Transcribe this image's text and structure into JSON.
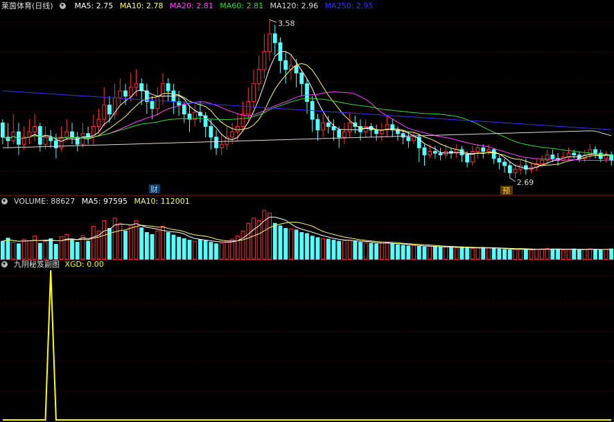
{
  "main_header": {
    "title": "莱茵体育(日线)",
    "ma5": "MA5: 2.75",
    "ma10": "MA10: 2.78",
    "ma20": "MA20: 2.81",
    "ma60": "MA60: 2.81",
    "ma120": "MA120: 2.96",
    "ma250": "MA250: 2.95"
  },
  "volume_header": {
    "title": "VOLUME: 88627",
    "ma5": "MA5: 97595",
    "ma10": "MA10: 112001"
  },
  "indicator_header": {
    "title": "九阴秘笈副图",
    "xgd": "XGD: 0.00"
  },
  "annotations": {
    "high_label": "3.58",
    "low_label": "2.69",
    "event_badge_1": "财",
    "event_badge_2": "预"
  },
  "colors": {
    "up": "#ff3333",
    "down": "#54ffff",
    "ma5": "#ffffff",
    "ma10": "#ffff66",
    "ma20": "#ff44ff",
    "ma60": "#33dd33",
    "ma120": "#dddddd",
    "ma250": "#3333ff",
    "divider": "#aa1111",
    "xgd": "#ffff00"
  },
  "chart_data": {
    "type": "candlestick",
    "price_range": [
      2.62,
      3.62
    ],
    "high_value": 3.58,
    "low_value": 2.69,
    "ohlc": [
      [
        3.0,
        2.92,
        3.02,
        2.88
      ],
      [
        2.92,
        2.9,
        3.0,
        2.86
      ],
      [
        2.9,
        2.95,
        3.05,
        2.88
      ],
      [
        2.95,
        2.88,
        3.0,
        2.82
      ],
      [
        2.88,
        2.92,
        2.98,
        2.85
      ],
      [
        2.92,
        2.95,
        3.02,
        2.88
      ],
      [
        2.95,
        2.98,
        3.05,
        2.9
      ],
      [
        2.98,
        2.88,
        3.0,
        2.84
      ],
      [
        2.88,
        2.92,
        2.98,
        2.85
      ],
      [
        2.92,
        2.9,
        2.96,
        2.86
      ],
      [
        2.9,
        2.86,
        2.94,
        2.8
      ],
      [
        2.86,
        2.92,
        2.98,
        2.84
      ],
      [
        2.92,
        2.95,
        3.02,
        2.9
      ],
      [
        2.95,
        2.92,
        3.0,
        2.88
      ],
      [
        2.92,
        2.88,
        2.95,
        2.84
      ],
      [
        2.88,
        2.94,
        3.0,
        2.86
      ],
      [
        2.94,
        2.92,
        2.98,
        2.88
      ],
      [
        2.92,
        2.98,
        3.05,
        2.88
      ],
      [
        2.98,
        3.02,
        3.08,
        2.94
      ],
      [
        3.02,
        3.1,
        3.2,
        2.98
      ],
      [
        3.1,
        3.05,
        3.15,
        3.0
      ],
      [
        3.05,
        3.14,
        3.22,
        3.02
      ],
      [
        3.14,
        3.18,
        3.25,
        3.1
      ],
      [
        3.18,
        3.15,
        3.22,
        3.1
      ],
      [
        3.15,
        3.2,
        3.28,
        3.12
      ],
      [
        3.2,
        3.22,
        3.3,
        3.15
      ],
      [
        3.22,
        3.18,
        3.25,
        3.1
      ],
      [
        3.18,
        3.12,
        3.22,
        3.05
      ],
      [
        3.12,
        3.08,
        3.15,
        3.02
      ],
      [
        3.08,
        3.15,
        3.2,
        3.04
      ],
      [
        3.15,
        3.22,
        3.28,
        3.1
      ],
      [
        3.22,
        3.18,
        3.25,
        3.12
      ],
      [
        3.18,
        3.12,
        3.22,
        3.05
      ],
      [
        3.12,
        3.1,
        3.18,
        3.04
      ],
      [
        3.1,
        3.05,
        3.12,
        3.0
      ],
      [
        3.05,
        3.02,
        3.1,
        2.95
      ],
      [
        3.02,
        3.06,
        3.1,
        2.98
      ],
      [
        3.06,
        3.04,
        3.12,
        3.0
      ],
      [
        3.04,
        2.98,
        3.06,
        2.92
      ],
      [
        2.98,
        2.92,
        3.02,
        2.85
      ],
      [
        2.92,
        2.86,
        2.96,
        2.82
      ],
      [
        2.86,
        2.88,
        2.94,
        2.82
      ],
      [
        2.88,
        2.92,
        2.98,
        2.85
      ],
      [
        2.92,
        2.95,
        3.0,
        2.88
      ],
      [
        2.95,
        2.98,
        3.05,
        2.9
      ],
      [
        2.98,
        3.05,
        3.12,
        2.95
      ],
      [
        3.05,
        3.12,
        3.2,
        3.0
      ],
      [
        3.12,
        3.22,
        3.3,
        3.08
      ],
      [
        3.22,
        3.3,
        3.38,
        3.18
      ],
      [
        3.3,
        3.4,
        3.5,
        3.25
      ],
      [
        3.4,
        3.5,
        3.58,
        3.35
      ],
      [
        3.5,
        3.45,
        3.55,
        3.38
      ],
      [
        3.45,
        3.35,
        3.48,
        3.28
      ],
      [
        3.35,
        3.3,
        3.4,
        3.22
      ],
      [
        3.3,
        3.32,
        3.38,
        3.24
      ],
      [
        3.32,
        3.28,
        3.36,
        3.2
      ],
      [
        3.28,
        3.22,
        3.3,
        3.15
      ],
      [
        3.22,
        3.12,
        3.25,
        3.05
      ],
      [
        3.12,
        3.02,
        3.15,
        2.95
      ],
      [
        3.02,
        2.96,
        3.05,
        2.9
      ],
      [
        2.96,
        3.0,
        3.05,
        2.92
      ],
      [
        3.0,
        2.98,
        3.04,
        2.94
      ],
      [
        2.98,
        2.96,
        3.02,
        2.9
      ],
      [
        2.96,
        2.92,
        2.98,
        2.86
      ],
      [
        2.92,
        2.95,
        3.0,
        2.88
      ],
      [
        2.95,
        3.0,
        3.06,
        2.92
      ],
      [
        3.0,
        2.98,
        3.04,
        2.94
      ],
      [
        2.98,
        2.95,
        3.02,
        2.9
      ],
      [
        2.95,
        2.98,
        3.02,
        2.92
      ],
      [
        2.98,
        2.96,
        3.0,
        2.92
      ],
      [
        2.96,
        2.94,
        2.99,
        2.9
      ],
      [
        2.94,
        2.96,
        3.0,
        2.9
      ],
      [
        2.96,
        2.99,
        3.04,
        2.92
      ],
      [
        2.99,
        2.96,
        3.02,
        2.92
      ],
      [
        2.96,
        2.94,
        2.98,
        2.9
      ],
      [
        2.94,
        2.92,
        2.96,
        2.88
      ],
      [
        2.92,
        2.9,
        2.95,
        2.86
      ],
      [
        2.9,
        2.92,
        2.95,
        2.88
      ],
      [
        2.92,
        2.86,
        2.94,
        2.78
      ],
      [
        2.86,
        2.82,
        2.88,
        2.76
      ],
      [
        2.82,
        2.84,
        2.88,
        2.8
      ],
      [
        2.84,
        2.83,
        2.87,
        2.8
      ],
      [
        2.83,
        2.82,
        2.86,
        2.79
      ],
      [
        2.82,
        2.84,
        2.88,
        2.8
      ],
      [
        2.84,
        2.83,
        2.86,
        2.8
      ],
      [
        2.83,
        2.85,
        2.88,
        2.8
      ],
      [
        2.85,
        2.82,
        2.87,
        2.78
      ],
      [
        2.82,
        2.78,
        2.84,
        2.75
      ],
      [
        2.78,
        2.84,
        2.87,
        2.76
      ],
      [
        2.84,
        2.86,
        2.88,
        2.8
      ],
      [
        2.86,
        2.84,
        2.88,
        2.8
      ],
      [
        2.84,
        2.85,
        2.88,
        2.82
      ],
      [
        2.85,
        2.8,
        2.86,
        2.77
      ],
      [
        2.8,
        2.78,
        2.82,
        2.74
      ],
      [
        2.78,
        2.76,
        2.8,
        2.72
      ],
      [
        2.76,
        2.72,
        2.78,
        2.69
      ],
      [
        2.72,
        2.74,
        2.77,
        2.69
      ],
      [
        2.74,
        2.76,
        2.79,
        2.71
      ],
      [
        2.76,
        2.74,
        2.8,
        2.71
      ],
      [
        2.74,
        2.75,
        2.78,
        2.72
      ],
      [
        2.75,
        2.77,
        2.8,
        2.73
      ],
      [
        2.77,
        2.79,
        2.82,
        2.75
      ],
      [
        2.79,
        2.82,
        2.85,
        2.77
      ],
      [
        2.82,
        2.8,
        2.85,
        2.78
      ],
      [
        2.8,
        2.79,
        2.83,
        2.76
      ],
      [
        2.79,
        2.81,
        2.84,
        2.78
      ],
      [
        2.81,
        2.83,
        2.86,
        2.79
      ],
      [
        2.83,
        2.82,
        2.85,
        2.8
      ],
      [
        2.82,
        2.8,
        2.84,
        2.78
      ],
      [
        2.8,
        2.82,
        2.85,
        2.78
      ],
      [
        2.82,
        2.85,
        2.88,
        2.8
      ],
      [
        2.85,
        2.83,
        2.87,
        2.8
      ],
      [
        2.83,
        2.8,
        2.85,
        2.78
      ],
      [
        2.8,
        2.82,
        2.84,
        2.78
      ],
      [
        2.82,
        2.79,
        2.84,
        2.76
      ]
    ],
    "volume": [
      70,
      82,
      66,
      60,
      78,
      72,
      90,
      62,
      70,
      80,
      58,
      88,
      96,
      74,
      66,
      92,
      70,
      128,
      110,
      150,
      120,
      160,
      140,
      110,
      134,
      150,
      122,
      104,
      96,
      110,
      128,
      104,
      94,
      86,
      80,
      74,
      70,
      76,
      72,
      66,
      60,
      62,
      70,
      78,
      90,
      110,
      140,
      160,
      150,
      190,
      180,
      140,
      130,
      120,
      118,
      114,
      104,
      100,
      90,
      84,
      80,
      78,
      74,
      70,
      72,
      74,
      70,
      66,
      64,
      62,
      60,
      62,
      64,
      60,
      56,
      54,
      52,
      54,
      50,
      48,
      50,
      48,
      46,
      48,
      46,
      44,
      46,
      44,
      42,
      44,
      46,
      44,
      42,
      40,
      38,
      36,
      38,
      40,
      38,
      36,
      38,
      40,
      42,
      40,
      38,
      36,
      38,
      40,
      36,
      38,
      40,
      38,
      36,
      38,
      40
    ],
    "xgd_signal_index": 9,
    "xgd_current": 0.0
  }
}
